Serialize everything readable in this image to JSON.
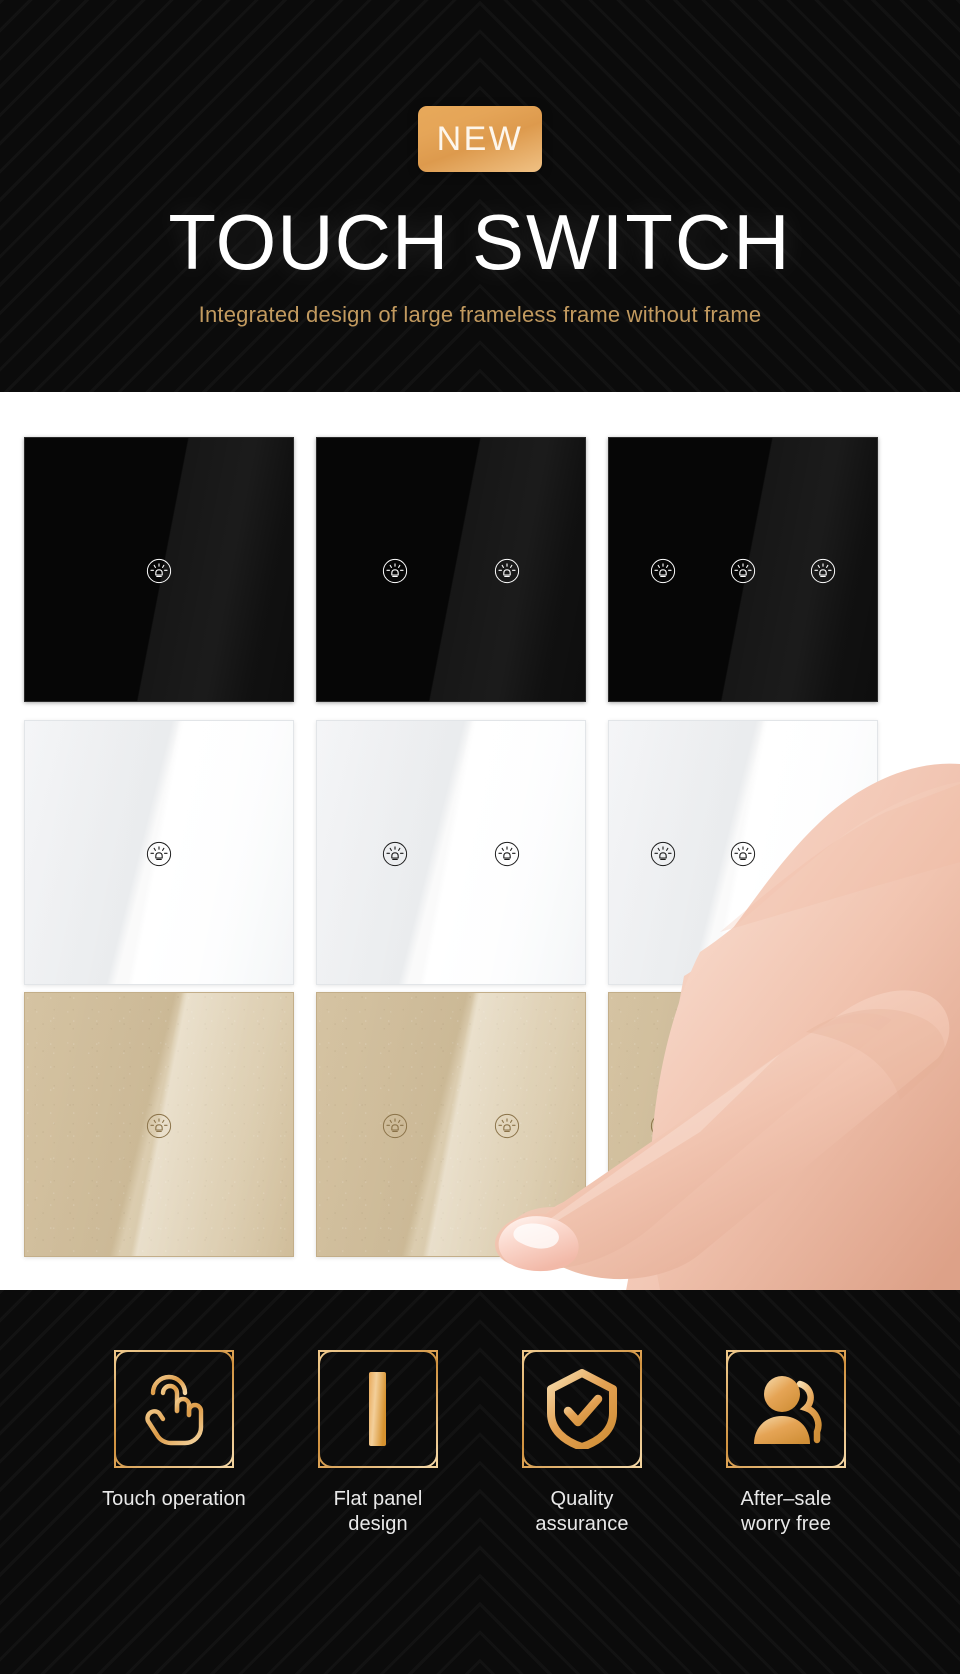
{
  "hero": {
    "badge_label": "NEW",
    "title_line1": "TOUCH",
    "title_line2": "SWITCH",
    "subtitle": "Integrated design of large frameless frame without frame",
    "badge_gradient_from": "#e8a95a",
    "badge_gradient_to": "#f0c184",
    "title_color": "#ffffff",
    "subtitle_color": "#c29a5f",
    "background_color": "#0b0b0b"
  },
  "products": {
    "background_color": "#ffffff",
    "icon_name": "light-bulb-touch-key-icon",
    "rows": [
      {
        "finish": "black",
        "finish_color": "#060606",
        "key_icon_color": "#ffffff",
        "panels": [
          {
            "gangs": 1,
            "name": "black-1-gang-touch-switch"
          },
          {
            "gangs": 2,
            "name": "black-2-gang-touch-switch"
          },
          {
            "gangs": 3,
            "name": "black-3-gang-touch-switch"
          }
        ]
      },
      {
        "finish": "white",
        "finish_color": "#f4f5f7",
        "key_icon_color": "#1a1a1a",
        "panels": [
          {
            "gangs": 1,
            "name": "white-1-gang-touch-switch"
          },
          {
            "gangs": 2,
            "name": "white-2-gang-touch-switch"
          },
          {
            "gangs": 3,
            "name": "white-3-gang-touch-switch"
          }
        ]
      },
      {
        "finish": "gold",
        "finish_color": "#d5c3a2",
        "key_icon_color": "#8a7248",
        "panels": [
          {
            "gangs": 1,
            "name": "gold-1-gang-touch-switch"
          },
          {
            "gangs": 2,
            "name": "gold-2-gang-touch-switch"
          },
          {
            "gangs": 3,
            "name": "gold-3-gang-touch-switch"
          }
        ]
      }
    ],
    "hand_name": "pointing-finger-hand-photo"
  },
  "features": {
    "background_color": "#0b0b0b",
    "accent_color": "#e2a95c",
    "label_color": "#e9e9e9",
    "items": [
      {
        "icon": "touch-hand-icon",
        "label": "Touch operation",
        "label_line1": "Touch operation",
        "label_line2": ""
      },
      {
        "icon": "flat-panel-bar-icon",
        "label": "Flat panel design",
        "label_line1": "Flat panel design",
        "label_line2": ""
      },
      {
        "icon": "shield-check-icon",
        "label": "Quality assurance",
        "label_line1": "Quality assurance",
        "label_line2": ""
      },
      {
        "icon": "two-users-icon",
        "label": "After–sale worry free",
        "label_line1": "After–sale",
        "label_line2": "worry free"
      }
    ]
  }
}
